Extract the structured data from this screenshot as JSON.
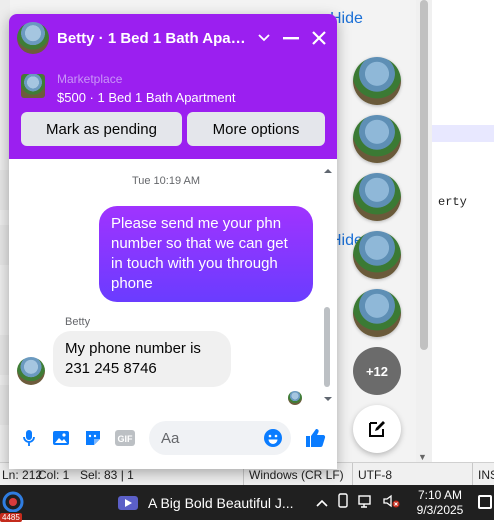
{
  "background": {
    "link_text": "Hide",
    "code_fragment": "erty",
    "status_bar": {
      "line": "Ln: 212",
      "col": "Col: 1",
      "sel": "Sel: 83 | 1",
      "eol": "Windows (CR LF)",
      "encoding": "UTF-8",
      "mode": "INS"
    }
  },
  "chat": {
    "title": "Betty · 1 Bed 1 Bath Apartment",
    "listing_label": "Marketplace",
    "listing_title": "$500 · 1 Bed 1 Bath Apartment",
    "actions": {
      "mark_pending": "Mark as pending",
      "more_options": "More options"
    },
    "timestamp": "Tue 10:19 AM",
    "messages": [
      {
        "from": "me",
        "text": "Please send me your phn number so that we can get in touch with you through phone"
      },
      {
        "from": "Betty",
        "sender_label": "Betty",
        "text": "My phone number is 231 245 8746"
      }
    ],
    "input_placeholder": "Aa"
  },
  "chatheads": {
    "more_count": "+12"
  },
  "taskbar": {
    "app_badge": "4485",
    "media_title": "A Big Bold Beautiful J...",
    "time": "7:10 AM",
    "date": "9/3/2025"
  },
  "colors": {
    "accent": "#9b1ff0",
    "bubble_out": "#7b3cff",
    "messenger_blue": "#0a7cff"
  }
}
